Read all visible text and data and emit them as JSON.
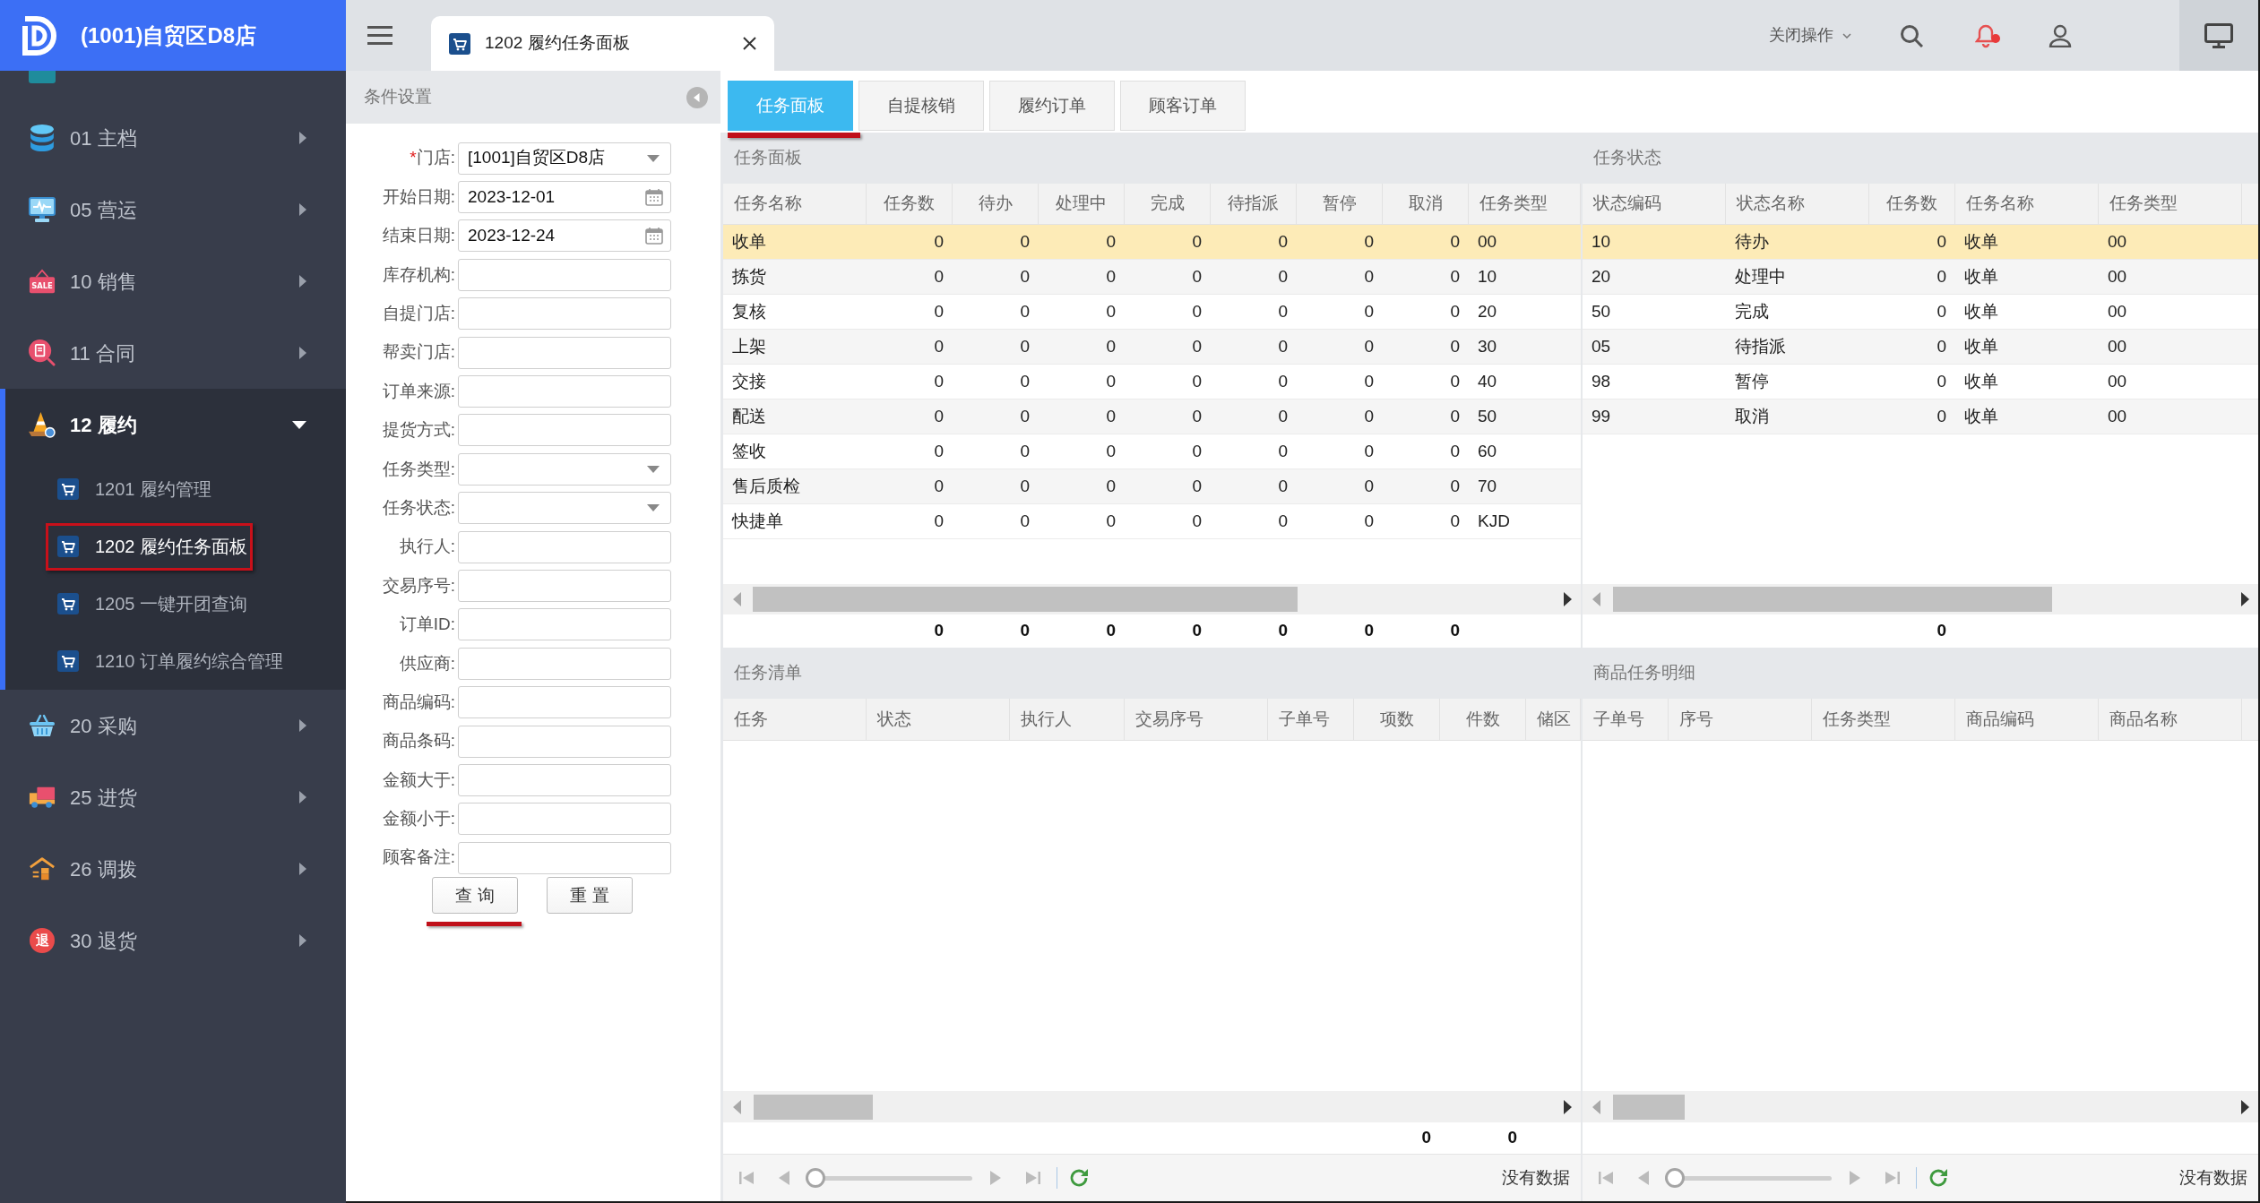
{
  "sidebar": {
    "title": "(1001)自贸区D8店",
    "groups": [
      {
        "label": "01 主档",
        "expanded": false
      },
      {
        "label": "05 营运",
        "expanded": false
      },
      {
        "label": "10 销售",
        "expanded": false,
        "icon_text": "SALE"
      },
      {
        "label": "11 合同",
        "expanded": false
      },
      {
        "label": "12 履约",
        "expanded": true,
        "children": [
          {
            "label": "1201 履约管理",
            "selected": false,
            "marked": false
          },
          {
            "label": "1202 履约任务面板",
            "selected": true,
            "marked": true
          },
          {
            "label": "1205 一键开团查询",
            "selected": false,
            "marked": false
          },
          {
            "label": "1210 订单履约综合管理",
            "selected": false,
            "marked": false
          }
        ]
      },
      {
        "label": "20 采购",
        "expanded": false
      },
      {
        "label": "25 进货",
        "expanded": false
      },
      {
        "label": "26 调拨",
        "expanded": false
      },
      {
        "label": "30 退货",
        "expanded": false,
        "icon_text": "退"
      }
    ]
  },
  "header": {
    "tab": {
      "label": "1202 履约任务面板"
    },
    "close_menu": "关闭操作"
  },
  "filter_panel": {
    "title": "条件设置",
    "fields": [
      {
        "label": "门店:",
        "required_mark": "*",
        "kind": "select",
        "value": "[1001]自贸区D8店"
      },
      {
        "label": "开始日期:",
        "kind": "date",
        "value": "2023-12-01"
      },
      {
        "label": "结束日期:",
        "kind": "date",
        "value": "2023-12-24"
      },
      {
        "label": "库存机构:",
        "kind": "text"
      },
      {
        "label": "自提门店:",
        "kind": "text"
      },
      {
        "label": "帮卖门店:",
        "kind": "text"
      },
      {
        "label": "订单来源:",
        "kind": "text"
      },
      {
        "label": "提货方式:",
        "kind": "text"
      },
      {
        "label": "任务类型:",
        "kind": "select"
      },
      {
        "label": "任务状态:",
        "kind": "select"
      },
      {
        "label": "执行人:",
        "kind": "text"
      },
      {
        "label": "交易序号:",
        "kind": "text"
      },
      {
        "label": "订单ID:",
        "kind": "text"
      },
      {
        "label": "供应商:",
        "kind": "text"
      },
      {
        "label": "商品编码:",
        "kind": "text"
      },
      {
        "label": "商品条码:",
        "kind": "text"
      },
      {
        "label": "金额大于:",
        "kind": "text"
      },
      {
        "label": "金额小于:",
        "kind": "text"
      },
      {
        "label": "顾客备注:",
        "kind": "text"
      }
    ],
    "buttons": [
      {
        "label": "查 询",
        "marked": true
      },
      {
        "label": "重 置",
        "marked": false
      }
    ]
  },
  "main_tabs": [
    {
      "label": "任务面板",
      "selected": true,
      "marked": true
    },
    {
      "label": "自提核销",
      "selected": false,
      "marked": false
    },
    {
      "label": "履约订单",
      "selected": false,
      "marked": false
    },
    {
      "label": "顾客订单",
      "selected": false,
      "marked": false
    }
  ],
  "task_board": {
    "title": "任务面板",
    "columns": [
      {
        "label": "任务名称",
        "kind": "text"
      },
      {
        "label": "任务数",
        "kind": "number"
      },
      {
        "label": "待办",
        "kind": "number"
      },
      {
        "label": "处理中",
        "kind": "number"
      },
      {
        "label": "完成",
        "kind": "number"
      },
      {
        "label": "待指派",
        "kind": "number"
      },
      {
        "label": "暂停",
        "kind": "number"
      },
      {
        "label": "取消",
        "kind": "number"
      },
      {
        "label": "任务类型",
        "kind": "text"
      }
    ],
    "rows": [
      {
        "selected": true,
        "cells": [
          "收单",
          "0",
          "0",
          "0",
          "0",
          "0",
          "0",
          "0",
          "00"
        ]
      },
      {
        "selected": false,
        "cells": [
          "拣货",
          "0",
          "0",
          "0",
          "0",
          "0",
          "0",
          "0",
          "10"
        ]
      },
      {
        "selected": false,
        "cells": [
          "复核",
          "0",
          "0",
          "0",
          "0",
          "0",
          "0",
          "0",
          "20"
        ]
      },
      {
        "selected": false,
        "cells": [
          "上架",
          "0",
          "0",
          "0",
          "0",
          "0",
          "0",
          "0",
          "30"
        ]
      },
      {
        "selected": false,
        "cells": [
          "交接",
          "0",
          "0",
          "0",
          "0",
          "0",
          "0",
          "0",
          "40"
        ]
      },
      {
        "selected": false,
        "cells": [
          "配送",
          "0",
          "0",
          "0",
          "0",
          "0",
          "0",
          "0",
          "50"
        ]
      },
      {
        "selected": false,
        "cells": [
          "签收",
          "0",
          "0",
          "0",
          "0",
          "0",
          "0",
          "0",
          "60"
        ]
      },
      {
        "selected": false,
        "cells": [
          "售后质检",
          "0",
          "0",
          "0",
          "0",
          "0",
          "0",
          "0",
          "70"
        ]
      },
      {
        "selected": false,
        "cells": [
          "快捷单",
          "0",
          "0",
          "0",
          "0",
          "0",
          "0",
          "0",
          "KJD"
        ]
      }
    ],
    "totals": [
      "0",
      "0",
      "0",
      "0",
      "0",
      "0",
      "0"
    ]
  },
  "task_status": {
    "title": "任务状态",
    "columns": [
      {
        "label": "状态编码",
        "kind": "text"
      },
      {
        "label": "状态名称",
        "kind": "text"
      },
      {
        "label": "任务数",
        "kind": "number"
      },
      {
        "label": "任务名称",
        "kind": "text"
      },
      {
        "label": "任务类型",
        "kind": "text"
      }
    ],
    "rows": [
      {
        "selected": true,
        "cells": [
          "10",
          "待办",
          "0",
          "收单",
          "00"
        ]
      },
      {
        "selected": false,
        "cells": [
          "20",
          "处理中",
          "0",
          "收单",
          "00"
        ]
      },
      {
        "selected": false,
        "cells": [
          "50",
          "完成",
          "0",
          "收单",
          "00"
        ]
      },
      {
        "selected": false,
        "cells": [
          "05",
          "待指派",
          "0",
          "收单",
          "00"
        ]
      },
      {
        "selected": false,
        "cells": [
          "98",
          "暂停",
          "0",
          "收单",
          "00"
        ]
      },
      {
        "selected": false,
        "cells": [
          "99",
          "取消",
          "0",
          "收单",
          "00"
        ]
      }
    ],
    "totals": [
      "0"
    ]
  },
  "task_list": {
    "title": "任务清单",
    "columns": [
      {
        "label": "任务",
        "kind": "text"
      },
      {
        "label": "状态",
        "kind": "text"
      },
      {
        "label": "执行人",
        "kind": "text"
      },
      {
        "label": "交易序号",
        "kind": "text"
      },
      {
        "label": "子单号",
        "kind": "text"
      },
      {
        "label": "项数",
        "kind": "number"
      },
      {
        "label": "件数",
        "kind": "number"
      },
      {
        "label": "储区",
        "kind": "text"
      }
    ],
    "totals": [
      "0",
      "0"
    ],
    "pager": {
      "level": 0,
      "status": "没有数据"
    }
  },
  "product_detail": {
    "title": "商品任务明细",
    "columns": [
      {
        "label": "子单号",
        "kind": "text"
      },
      {
        "label": "序号",
        "kind": "text"
      },
      {
        "label": "任务类型",
        "kind": "text"
      },
      {
        "label": "商品编码",
        "kind": "text"
      },
      {
        "label": "商品名称",
        "kind": "text"
      }
    ],
    "pager": {
      "level": 0,
      "status": "没有数据"
    }
  }
}
